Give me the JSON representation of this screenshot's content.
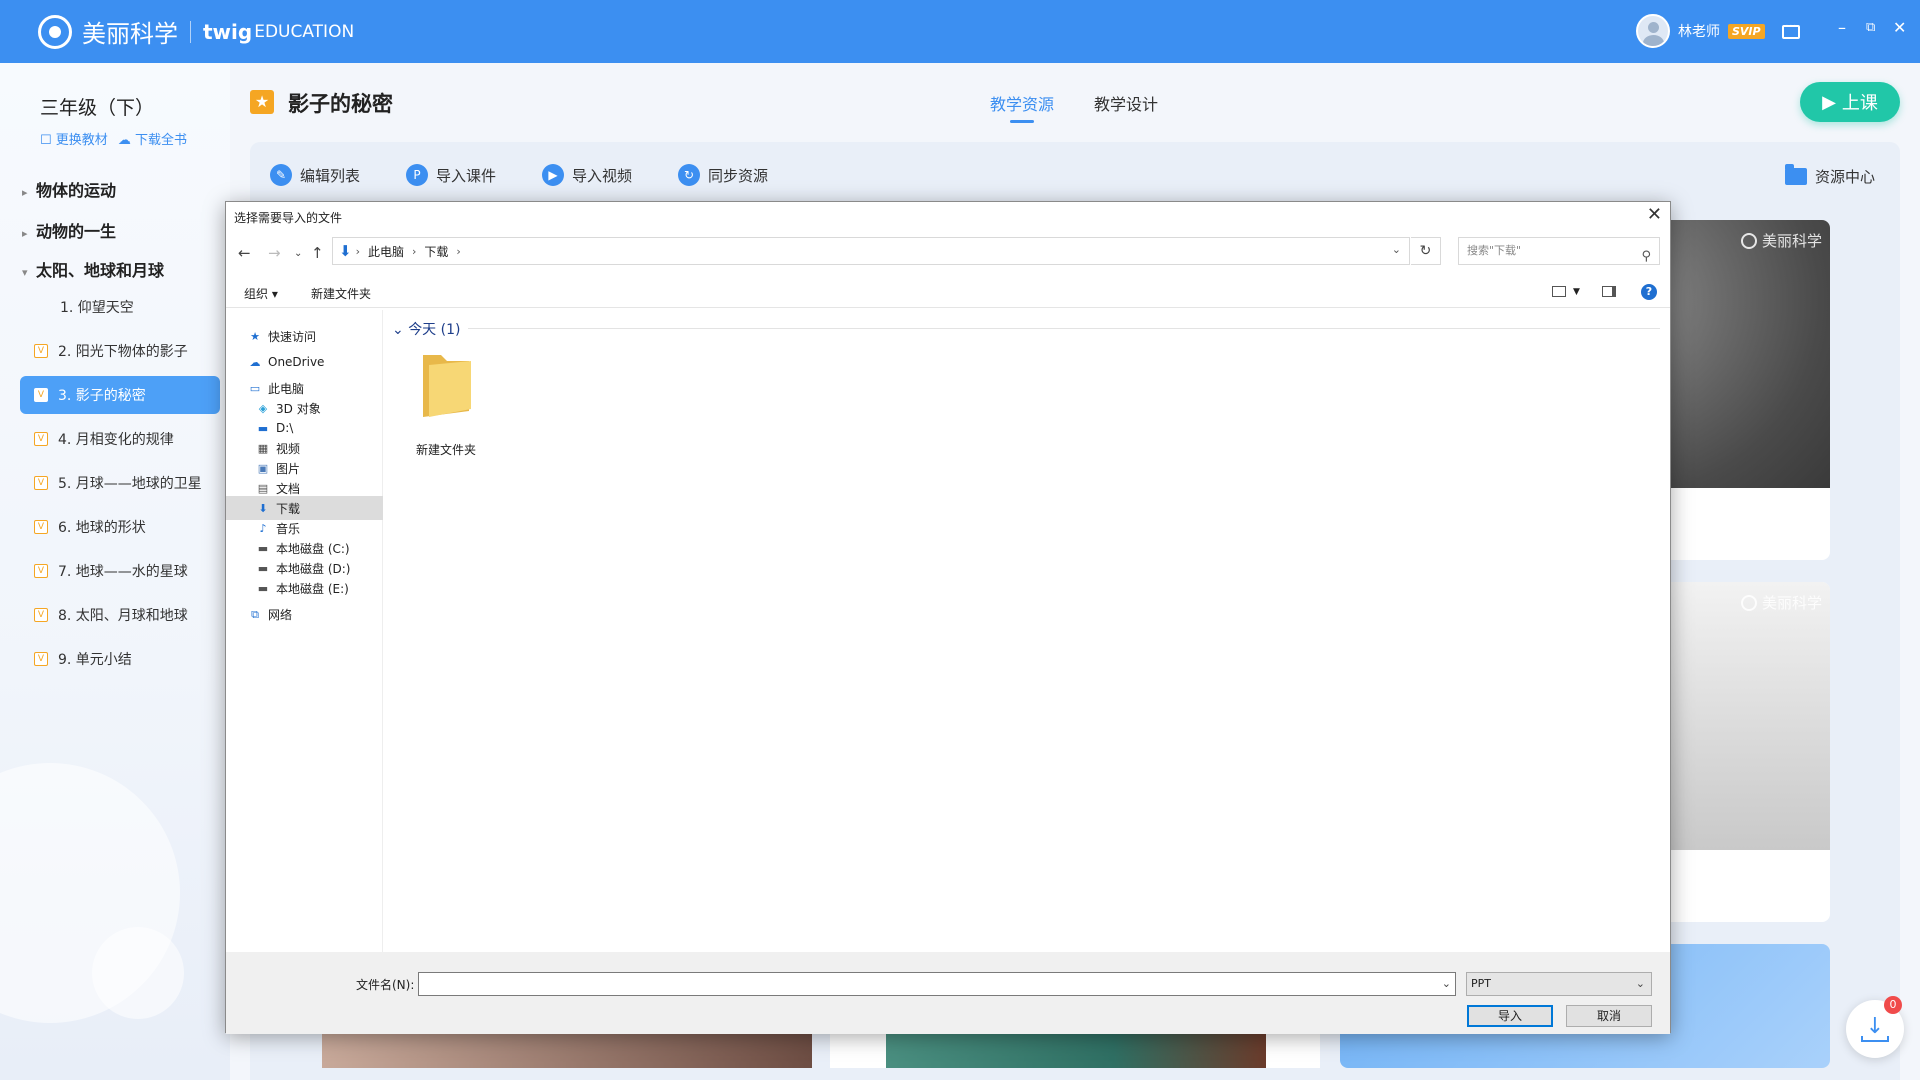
{
  "topbar": {
    "brand": "美丽科学",
    "partner_main": "twig",
    "partner_sub": "EDUCATION",
    "user_name": "林老师",
    "badge": "SVIP",
    "win_min": "–",
    "win_restore": "⧉",
    "win_close": "✕",
    "accent": "#3c8ff1"
  },
  "sidebar": {
    "grade": "三年级（下）",
    "change_book": "更换教材",
    "download_book": "下载全书",
    "units": [
      {
        "label": "物体的运动",
        "expanded": false
      },
      {
        "label": "动物的一生",
        "expanded": false
      },
      {
        "label": "太阳、地球和月球",
        "expanded": true
      }
    ],
    "lessons": [
      {
        "label": "1. 仰望天空",
        "badge": ""
      },
      {
        "label": "2. 阳光下物体的影子",
        "badge": "V"
      },
      {
        "label": "3. 影子的秘密",
        "badge": "V"
      },
      {
        "label": "4. 月相变化的规律",
        "badge": "V"
      },
      {
        "label": "5. 月球——地球的卫星",
        "badge": "V"
      },
      {
        "label": "6. 地球的形状",
        "badge": "V"
      },
      {
        "label": "7. 地球——水的星球",
        "badge": "V"
      },
      {
        "label": "8. 太阳、月球和地球",
        "badge": "V"
      },
      {
        "label": "9. 单元小结",
        "badge": "V"
      }
    ],
    "active_lesson": "3. 影子的秘密"
  },
  "main": {
    "title": "影子的秘密",
    "tabs": [
      {
        "label": "教学资源",
        "active": true
      },
      {
        "label": "教学设计",
        "active": false
      }
    ],
    "start_button": "上课",
    "tools": [
      {
        "label": "编辑列表",
        "icon": "edit-icon"
      },
      {
        "label": "导入课件",
        "icon": "ppt-icon"
      },
      {
        "label": "导入视频",
        "icon": "video-icon"
      },
      {
        "label": "同步资源",
        "icon": "sync-icon"
      }
    ],
    "resource_center": "资源中心",
    "watermark": "美丽科学",
    "download_count": "0"
  },
  "dialog": {
    "title": "选择需要导入的文件",
    "breadcrumb": [
      "此电脑",
      "下载"
    ],
    "search_placeholder": "搜索\"下载\"",
    "organize": "组织 ▾",
    "new_folder": "新建文件夹",
    "nav": [
      {
        "label": "快速访问",
        "icon": "star-icon"
      },
      {
        "label": "OneDrive",
        "icon": "cloud-icon"
      },
      {
        "label": "此电脑",
        "icon": "computer-icon"
      },
      {
        "label": "3D 对象",
        "icon": "cube-icon"
      },
      {
        "label": "D:\\",
        "icon": "drive-icon"
      },
      {
        "label": "视频",
        "icon": "video-folder-icon"
      },
      {
        "label": "图片",
        "icon": "picture-folder-icon"
      },
      {
        "label": "文档",
        "icon": "document-folder-icon"
      },
      {
        "label": "下载",
        "icon": "download-folder-icon"
      },
      {
        "label": "音乐",
        "icon": "music-folder-icon"
      },
      {
        "label": "本地磁盘 (C:)",
        "icon": "disk-icon"
      },
      {
        "label": "本地磁盘 (D:)",
        "icon": "disk-icon"
      },
      {
        "label": "本地磁盘 (E:)",
        "icon": "disk-icon"
      },
      {
        "label": "网络",
        "icon": "network-icon"
      }
    ],
    "selected_nav": "下载",
    "group_header": "今天 (1)",
    "items": [
      {
        "label": "新建文件夹",
        "icon": "folder-icon"
      }
    ],
    "filename_label": "文件名(N):",
    "filename_value": "",
    "filetype": "PPT",
    "import_button": "导入",
    "cancel_button": "取消"
  }
}
